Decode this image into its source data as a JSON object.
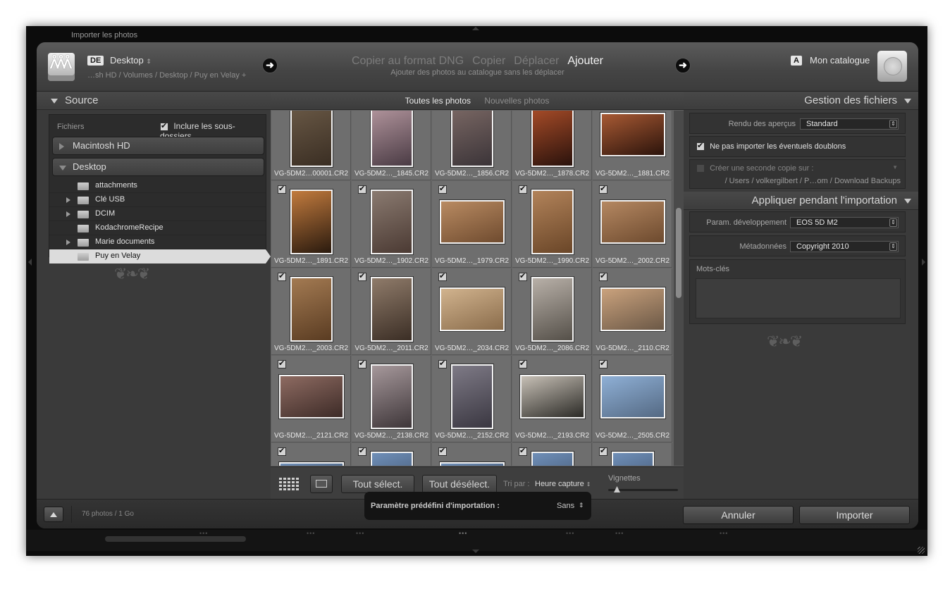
{
  "window": {
    "title": "Importer les photos"
  },
  "header": {
    "source": {
      "badge": "DE",
      "name": "Desktop",
      "path": "…sh HD / Volumes / Desktop / Puy en Velay +"
    },
    "modes": [
      {
        "label": "Copier au format DNG",
        "selected": false
      },
      {
        "label": "Copier",
        "selected": false
      },
      {
        "label": "Déplacer",
        "selected": false
      },
      {
        "label": "Ajouter",
        "selected": true
      }
    ],
    "mode_description": "Ajouter des photos au catalogue sans les déplacer",
    "destination": {
      "badge": "A",
      "name": "Mon catalogue"
    }
  },
  "source_panel": {
    "title": "Source",
    "files_label": "Fichiers",
    "include_subfolders_label": "Inclure les sous-dossiers",
    "include_subfolders_checked": true,
    "volumes": [
      "Macintosh HD",
      "Desktop"
    ],
    "folders": [
      {
        "label": "attachments",
        "expandable": false,
        "selected": false
      },
      {
        "label": "Clé USB",
        "expandable": true,
        "selected": false
      },
      {
        "label": "DCIM",
        "expandable": true,
        "selected": false
      },
      {
        "label": "KodachromeRecipe",
        "expandable": false,
        "selected": false
      },
      {
        "label": "Marie documents",
        "expandable": true,
        "selected": false
      },
      {
        "label": "Puy en Velay",
        "expandable": false,
        "selected": true
      }
    ]
  },
  "center": {
    "filters": [
      {
        "label": "Toutes les photos",
        "selected": true
      },
      {
        "label": "Nouvelles photos",
        "selected": false
      }
    ],
    "photos": [
      {
        "name": "VG-5DM2…00001.CR2",
        "checked": false,
        "colors": [
          "#6b5a47",
          "#3a2e23"
        ],
        "orientation": "portrait"
      },
      {
        "name": "VG-5DM2…_1845.CR2",
        "checked": false,
        "colors": [
          "#b89aa2",
          "#4a3b44"
        ],
        "orientation": "portrait"
      },
      {
        "name": "VG-5DM2…_1856.CR2",
        "checked": false,
        "colors": [
          "#7d6a66",
          "#3b3438"
        ],
        "orientation": "portrait"
      },
      {
        "name": "VG-5DM2…_1878.CR2",
        "checked": false,
        "colors": [
          "#b0502a",
          "#2a120c"
        ],
        "orientation": "portrait"
      },
      {
        "name": "VG-5DM2…_1881.CR2",
        "checked": false,
        "colors": [
          "#a85a34",
          "#2b130b"
        ],
        "orientation": "landscape"
      },
      {
        "name": "VG-5DM2…_1891.CR2",
        "checked": true,
        "colors": [
          "#c27b3e",
          "#2a1a0e"
        ],
        "orientation": "portrait"
      },
      {
        "name": "VG-5DM2…_1902.CR2",
        "checked": true,
        "colors": [
          "#8a7a70",
          "#4b3a33"
        ],
        "orientation": "portrait"
      },
      {
        "name": "VG-5DM2…_1979.CR2",
        "checked": true,
        "colors": [
          "#b98b62",
          "#6f4b2f"
        ],
        "orientation": "landscape"
      },
      {
        "name": "VG-5DM2…_1990.CR2",
        "checked": true,
        "colors": [
          "#b2835a",
          "#6a4628"
        ],
        "orientation": "portrait"
      },
      {
        "name": "VG-5DM2…_2002.CR2",
        "checked": true,
        "colors": [
          "#b58862",
          "#6d4a2e"
        ],
        "orientation": "landscape"
      },
      {
        "name": "VG-5DM2…_2003.CR2",
        "checked": true,
        "colors": [
          "#a37a52",
          "#5a3c22"
        ],
        "orientation": "portrait"
      },
      {
        "name": "VG-5DM2…_2011.CR2",
        "checked": true,
        "colors": [
          "#8f7b6a",
          "#3b2e25"
        ],
        "orientation": "portrait"
      },
      {
        "name": "VG-5DM2…_2034.CR2",
        "checked": true,
        "colors": [
          "#d1b38e",
          "#8a6c4b"
        ],
        "orientation": "landscape"
      },
      {
        "name": "VG-5DM2…_2086.CR2",
        "checked": true,
        "colors": [
          "#b8b0a8",
          "#555049"
        ],
        "orientation": "portrait"
      },
      {
        "name": "VG-5DM2…_2110.CR2",
        "checked": true,
        "colors": [
          "#caa27d",
          "#6b5846"
        ],
        "orientation": "landscape"
      },
      {
        "name": "VG-5DM2…_2121.CR2",
        "checked": true,
        "colors": [
          "#8e6b62",
          "#3d2b27"
        ],
        "orientation": "landscape"
      },
      {
        "name": "VG-5DM2…_2138.CR2",
        "checked": true,
        "colors": [
          "#a6989b",
          "#3e3639"
        ],
        "orientation": "portrait"
      },
      {
        "name": "VG-5DM2…_2152.CR2",
        "checked": true,
        "colors": [
          "#7e7a86",
          "#3a3741"
        ],
        "orientation": "portrait"
      },
      {
        "name": "VG-5DM2…_2193.CR2",
        "checked": true,
        "colors": [
          "#c7c0b6",
          "#2b2a26"
        ],
        "orientation": "landscape"
      },
      {
        "name": "VG-5DM2…_2505.CR2",
        "checked": true,
        "colors": [
          "#8fb0d6",
          "#546983"
        ],
        "orientation": "landscape"
      },
      {
        "name": "",
        "checked": true,
        "colors": [
          "#6f8fb8",
          "#2e3c52"
        ],
        "orientation": "landscape"
      },
      {
        "name": "",
        "checked": true,
        "colors": [
          "#6f8fb8",
          "#2e3c52"
        ],
        "orientation": "portrait"
      },
      {
        "name": "",
        "checked": true,
        "colors": [
          "#6f8fb8",
          "#2e3c52"
        ],
        "orientation": "landscape"
      },
      {
        "name": "",
        "checked": true,
        "colors": [
          "#6f8fb8",
          "#2e3c52"
        ],
        "orientation": "portrait"
      },
      {
        "name": "",
        "checked": true,
        "colors": [
          "#6f8fb8",
          "#2e3c52"
        ],
        "orientation": "portrait"
      }
    ],
    "toolbar": {
      "select_all": "Tout sélect.",
      "deselect_all": "Tout désélect.",
      "sort_label": "Tri par :",
      "sort_value": "Heure capture",
      "thumbnails_label": "Vignettes"
    }
  },
  "right_panel": {
    "file_handling": {
      "title": "Gestion des fichiers",
      "preview_label": "Rendu des aperçus",
      "preview_value": "Standard",
      "no_duplicates_label": "Ne pas importer les éventuels doublons",
      "no_duplicates_checked": true,
      "second_copy_label": "Créer une seconde copie sur :",
      "second_copy_checked": false,
      "second_copy_path": "/ Users / volkergilbert / P…om / Download Backups"
    },
    "apply_during_import": {
      "title": "Appliquer pendant l'importation",
      "develop_label": "Param. développement",
      "develop_value": "EOS 5D M2",
      "metadata_label": "Métadonnées",
      "metadata_value": "Copyright 2010",
      "keywords_label": "Mots-clés"
    }
  },
  "footer": {
    "count": "76 photos / 1 Go",
    "preset_label": "Paramètre prédéfini d'importation :",
    "preset_value": "Sans",
    "cancel": "Annuler",
    "import": "Importer"
  }
}
